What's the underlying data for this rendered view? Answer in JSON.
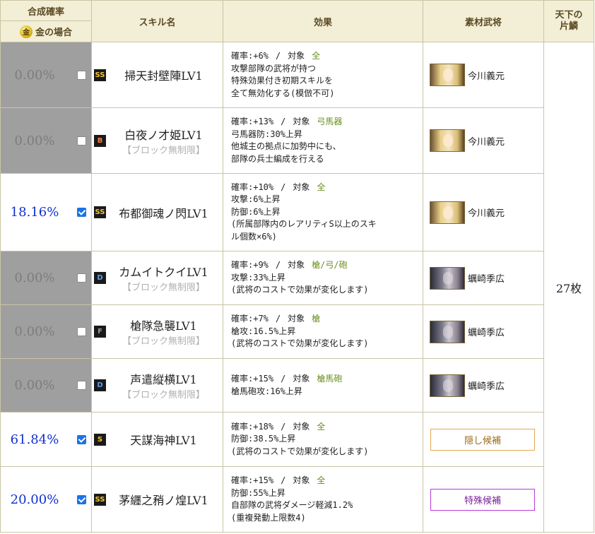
{
  "header": {
    "rate_title": "合成確率",
    "gold_icon": "金",
    "gold_label": "金の場合",
    "skill_name": "スキル名",
    "effect": "効果",
    "material": "素材武将",
    "fragments_title": "天下の片鱗"
  },
  "fragments_value": "27枚",
  "colors": {
    "header_bg": "#f3eed6",
    "disabled_bg": "#9f9f9f",
    "prob_blue": "#1030d0",
    "target_green": "#6a8f1e"
  },
  "rows": [
    {
      "prob": "0.00%",
      "checked": false,
      "rank": "SS",
      "rank_color": "#f4c430",
      "skill": "掃天封壁陣LV1",
      "block_note": "",
      "effect": {
        "rate_label": "確率:+6%",
        "sep": "/",
        "target_label": "対象",
        "target": "全",
        "lines": [
          "攻撃部隊の武将が持つ",
          "特殊効果付き初期スキルを",
          "全て無効化する(模倣不可)"
        ]
      },
      "material": {
        "type": "general",
        "name": "今川義元",
        "portrait": "blonde"
      }
    },
    {
      "prob": "0.00%",
      "checked": false,
      "rank": "B",
      "rank_color": "#ff8040",
      "skill": "白夜ノ才姫LV1",
      "block_note": "【ブロック無制限】",
      "effect": {
        "rate_label": "確率:+13%",
        "sep": "/",
        "target_label": "対象",
        "target": "弓馬器",
        "lines": [
          "弓馬器防:30%上昇",
          "他城主の拠点に加勢中にも、",
          "部隊の兵士編成を行える"
        ]
      },
      "material": {
        "type": "general",
        "name": "今川義元",
        "portrait": "blonde"
      }
    },
    {
      "prob": "18.16%",
      "checked": true,
      "rank": "SS",
      "rank_color": "#f4c430",
      "skill": "布都御魂ノ閃LV1",
      "block_note": "",
      "effect": {
        "rate_label": "確率:+10%",
        "sep": "/",
        "target_label": "対象",
        "target": "全",
        "lines": [
          "攻撃:6%上昇",
          "防御:6%上昇",
          "(所属部隊内のレアリティS以上のスキ",
          "ル個数×6%)"
        ]
      },
      "material": {
        "type": "general",
        "name": "今川義元",
        "portrait": "blonde"
      }
    },
    {
      "prob": "0.00%",
      "checked": false,
      "rank": "D",
      "rank_color": "#5aa0f0",
      "skill": "カムイトクイLV1",
      "block_note": "【ブロック無制限】",
      "effect": {
        "rate_label": "確率:+9%",
        "sep": "/",
        "target_label": "対象",
        "target": "槍/弓/砲",
        "lines": [
          "攻撃:33%上昇",
          "(武将のコストで効果が変化します)"
        ]
      },
      "material": {
        "type": "general",
        "name": "蠣崎季広",
        "portrait": "grey"
      }
    },
    {
      "prob": "0.00%",
      "checked": false,
      "rank": "F",
      "rank_color": "#9a9a9a",
      "skill": "槍隊急襲LV1",
      "block_note": "【ブロック無制限】",
      "effect": {
        "rate_label": "確率:+7%",
        "sep": "/",
        "target_label": "対象",
        "target": "槍",
        "lines": [
          "槍攻:16.5%上昇",
          "(武将のコストで効果が変化します)"
        ]
      },
      "material": {
        "type": "general",
        "name": "蠣崎季広",
        "portrait": "grey"
      }
    },
    {
      "prob": "0.00%",
      "checked": false,
      "rank": "D",
      "rank_color": "#5aa0f0",
      "skill": "声遣縦横LV1",
      "block_note": "【ブロック無制限】",
      "effect": {
        "rate_label": "確率:+15%",
        "sep": "/",
        "target_label": "対象",
        "target": "槍馬砲",
        "lines": [
          "槍馬砲攻:16%上昇"
        ]
      },
      "material": {
        "type": "general",
        "name": "蠣崎季広",
        "portrait": "grey"
      }
    },
    {
      "prob": "61.84%",
      "checked": true,
      "rank": "S",
      "rank_color": "#f4c430",
      "skill": "天謀海神LV1",
      "block_note": "",
      "effect": {
        "rate_label": "確率:+18%",
        "sep": "/",
        "target_label": "対象",
        "target": "全",
        "lines": [
          "防御:38.5%上昇",
          "(武将のコストで効果が変化します)"
        ]
      },
      "material": {
        "type": "hidden",
        "name": "隠し候補"
      }
    },
    {
      "prob": "20.00%",
      "checked": true,
      "rank": "SS",
      "rank_color": "#f4c430",
      "skill": "茅纒之矟ノ煌LV1",
      "block_note": "",
      "effect": {
        "rate_label": "確率:+15%",
        "sep": "/",
        "target_label": "対象",
        "target": "全",
        "lines": [
          "防御:55%上昇",
          "自部隊の武将ダメージ軽減1.2%",
          "(重複発動上限数4)"
        ]
      },
      "material": {
        "type": "special",
        "name": "特殊候補"
      }
    }
  ]
}
